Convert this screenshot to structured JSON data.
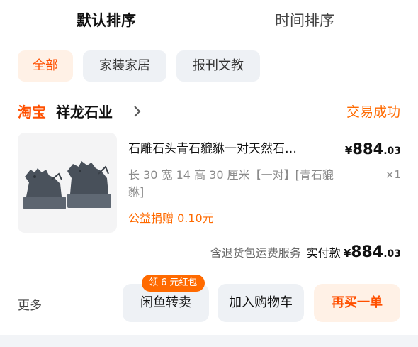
{
  "sort_tabs": {
    "default_label": "默认排序",
    "time_label": "时间排序"
  },
  "filters": {
    "all": "全部",
    "home": "家装家居",
    "books": "报刊文教"
  },
  "order": {
    "platform_logo": "淘宝",
    "shop_name": "祥龙石业",
    "status": "交易成功",
    "product_title": "石雕石头青石貔貅一对天然石…",
    "price": {
      "currency": "¥",
      "integer": "884",
      "decimal": ".03"
    },
    "sku": "长 30 宽 14 高 30 厘米【一对】[青石貔貅]",
    "quantity": "×1",
    "charity": "公益捐赠 0.10元",
    "services": "含退货包运费服务",
    "paid_label": "实付款",
    "paid": {
      "currency": "¥",
      "integer": "884",
      "decimal": ".03"
    }
  },
  "actions": {
    "more": "更多",
    "resell": "闲鱼转卖",
    "coupon_badge": "领 6 元红包",
    "add_to_cart": "加入购物车",
    "buy_again": "再买一单"
  },
  "colors": {
    "accent": "#ff5000",
    "chip_bg": "#eef1f5",
    "chip_active_bg": "#fff1e6"
  }
}
